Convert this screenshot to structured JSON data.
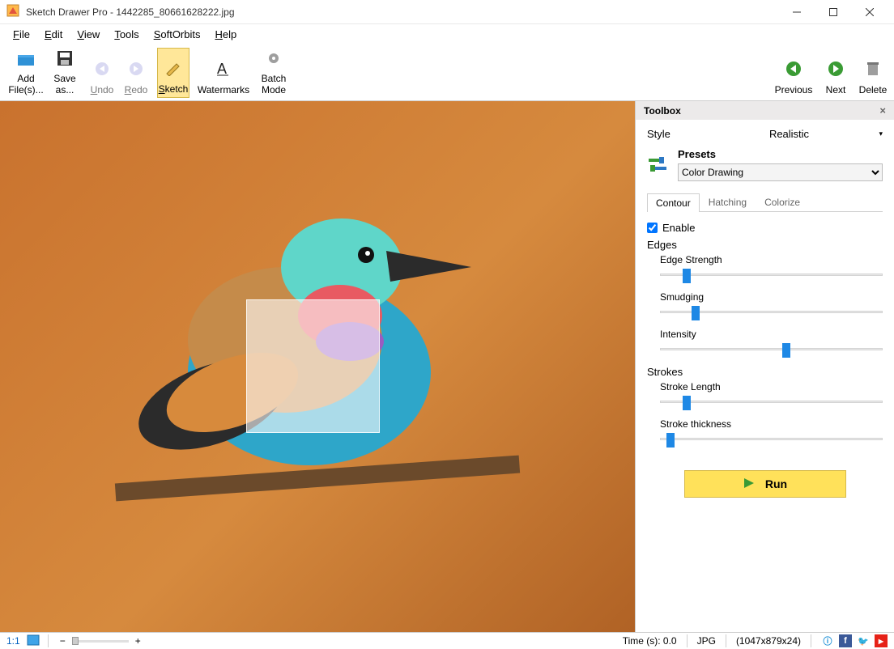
{
  "window": {
    "title": "Sketch Drawer Pro - 1442285_80661628222.jpg"
  },
  "menu": {
    "file": "File",
    "edit": "Edit",
    "view": "View",
    "tools": "Tools",
    "softorbits": "SoftOrbits",
    "help": "Help"
  },
  "toolbar": {
    "add_files": "Add File(s)...",
    "save_as": "Save as...",
    "undo": "Undo",
    "redo": "Redo",
    "sketch": "Sketch",
    "watermarks": "Watermarks",
    "batch_mode": "Batch Mode",
    "previous": "Previous",
    "next": "Next",
    "delete": "Delete"
  },
  "toolbox": {
    "title": "Toolbox",
    "style_label": "Style",
    "style_value": "Realistic",
    "presets_label": "Presets",
    "preset_selected": "Color Drawing",
    "tabs": {
      "contour": "Contour",
      "hatching": "Hatching",
      "colorize": "Colorize"
    },
    "enable": "Enable",
    "edges_group": "Edges",
    "edge_strength": "Edge Strength",
    "smudging": "Smudging",
    "intensity": "Intensity",
    "strokes_group": "Strokes",
    "stroke_length": "Stroke Length",
    "stroke_thickness": "Stroke thickness",
    "run": "Run",
    "slider_positions": {
      "edge_strength": 10,
      "smudging": 14,
      "intensity": 55,
      "stroke_length": 10,
      "stroke_thickness": 3
    }
  },
  "status": {
    "zoom_label": "1:1",
    "time": "Time (s): 0.0",
    "format": "JPG",
    "dimensions": "(1047x879x24)"
  }
}
